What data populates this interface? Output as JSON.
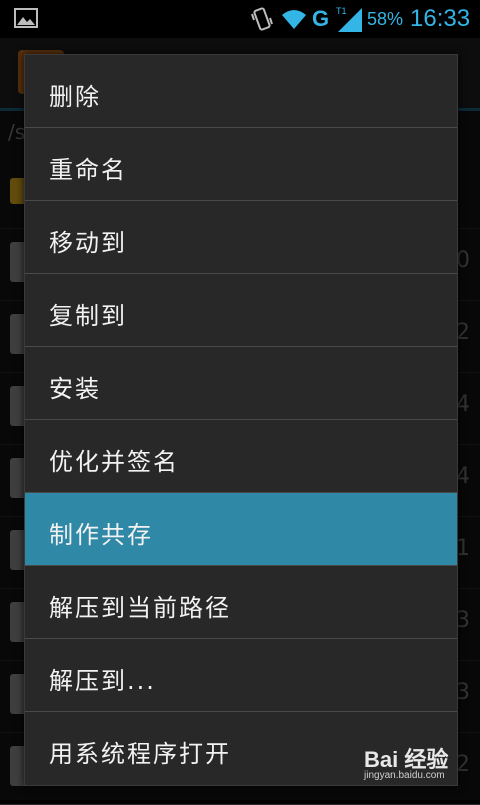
{
  "status_bar": {
    "network_type": "G",
    "battery": "58%",
    "time": "16:33",
    "accent_color": "#33b5e5"
  },
  "background": {
    "path_fragment": "/s",
    "right_numbers": [
      "0",
      "2",
      "4",
      "4",
      "1",
      "3",
      "3",
      "2"
    ]
  },
  "menu": {
    "items": [
      {
        "label": "删除"
      },
      {
        "label": "重命名"
      },
      {
        "label": "移动到"
      },
      {
        "label": "复制到"
      },
      {
        "label": "安装"
      },
      {
        "label": "优化并签名"
      },
      {
        "label": "制作共存"
      },
      {
        "label": "解压到当前路径"
      },
      {
        "label": "解压到..."
      },
      {
        "label": "用系统程序打开"
      }
    ],
    "selected_index": 6,
    "selected_color": "#2f88a6"
  },
  "watermark": {
    "logo": "Bai 经验",
    "text": "jingyan.baidu.com"
  }
}
